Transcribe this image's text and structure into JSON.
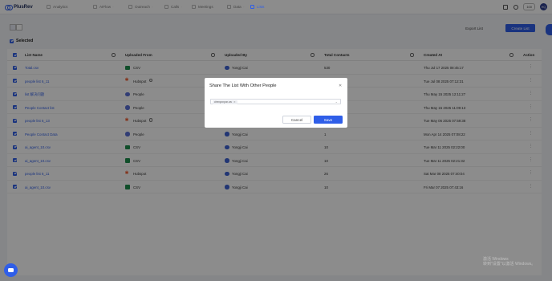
{
  "brand": {
    "name": "PlusRev"
  },
  "nav": [
    {
      "label": "Analytics",
      "icon": "chart-icon",
      "active": false,
      "chevron": false
    },
    {
      "label": "AIFlow",
      "icon": "flow-icon",
      "active": false,
      "chevron": true
    },
    {
      "label": "Outreach",
      "icon": "send-icon",
      "active": false,
      "chevron": true
    },
    {
      "label": "Calls",
      "icon": "phone-icon",
      "active": false,
      "chevron": true
    },
    {
      "label": "Meetings",
      "icon": "calendar-icon",
      "active": false,
      "chevron": false
    },
    {
      "label": "Data",
      "icon": "database-icon",
      "active": false,
      "chevron": true
    },
    {
      "label": "Lists",
      "icon": "list-icon",
      "active": true,
      "chevron": false
    }
  ],
  "topbar": {
    "credits": "100",
    "avatar_initials": "HQ"
  },
  "toolbar": {
    "export_label": "Export List",
    "create_label": "Create List"
  },
  "selection": {
    "label": "Selected"
  },
  "table": {
    "columns": [
      "List Name",
      "Uploaded From",
      "Uploaded By",
      "Total Contacts",
      "Created At",
      "Action"
    ],
    "rows": [
      {
        "name": "Total.csv",
        "source": "CSV",
        "source_icon": "csv-icon",
        "info": false,
        "uploader": "Yongji Cai",
        "contacts": "530",
        "created": "Thu Jul 17 2025 08:45:17"
      },
      {
        "name": "people list 6_11",
        "source": "Hubspot",
        "source_icon": "hubspot-icon",
        "info": true,
        "uploader": "Yongji Cai",
        "contacts": "2",
        "created": "Tue Jul 08 2025 07:12:31"
      },
      {
        "name": "list 解决问题",
        "source": "People",
        "source_icon": "people-icon",
        "info": false,
        "uploader": "Yongji Cai",
        "contacts": "1",
        "created": "Thu May 15 2025 12:11:27"
      },
      {
        "name": "People Contact list",
        "source": "People",
        "source_icon": "people-icon",
        "info": false,
        "uploader": "Yongji Cai",
        "contacts": "1",
        "created": "Thu May 15 2025 11:09:13"
      },
      {
        "name": "people list 6_13",
        "source": "Hubspot",
        "source_icon": "hubspot-icon",
        "info": true,
        "uploader": "Yongji Cai",
        "contacts": "1",
        "created": "Tue May 06 2025 07:59:38"
      },
      {
        "name": "People Contact Data",
        "source": "People",
        "source_icon": "people-icon",
        "info": false,
        "uploader": "Yongji Cai",
        "contacts": "1",
        "created": "Mon Apr 14 2025 07:08:22"
      },
      {
        "name": "ai_agent_10.csv",
        "source": "CSV",
        "source_icon": "csv-icon",
        "info": false,
        "uploader": "Yongji Cai",
        "contacts": "10",
        "created": "Tue Mar 11 2025 02:22:00"
      },
      {
        "name": "ai_agent_10.csv",
        "source": "CSV",
        "source_icon": "csv-icon",
        "info": false,
        "uploader": "Yongji Cai",
        "contacts": "10",
        "created": "Tue Mar 11 2025 02:21:32"
      },
      {
        "name": "people list 6_11",
        "source": "Hubspot",
        "source_icon": "hubspot-icon",
        "info": false,
        "uploader": "Yongji Cai",
        "contacts": "26",
        "created": "Sat Mar 08 2025 07:40:04"
      },
      {
        "name": "ai_agent_10.csv",
        "source": "CSV",
        "source_icon": "csv-icon",
        "info": false,
        "uploader": "Yongji Cai",
        "contacts": "10",
        "created": "Fri Mar 07 2025 07:43:16"
      }
    ]
  },
  "modal": {
    "title": "Share The List With Other People",
    "chip_label": "chenyunyun.wu",
    "cancel_label": "Cancel",
    "save_label": "Save"
  },
  "watermark": {
    "line1": "激活 Windows",
    "line2": "转到\"设置\"以激活 Windows。"
  },
  "colors": {
    "accent": "#2f5ee8",
    "csv": "#1e8e4e",
    "hubspot": "#ee5b2f",
    "overlay": "rgba(0,0,0,0.45)"
  }
}
